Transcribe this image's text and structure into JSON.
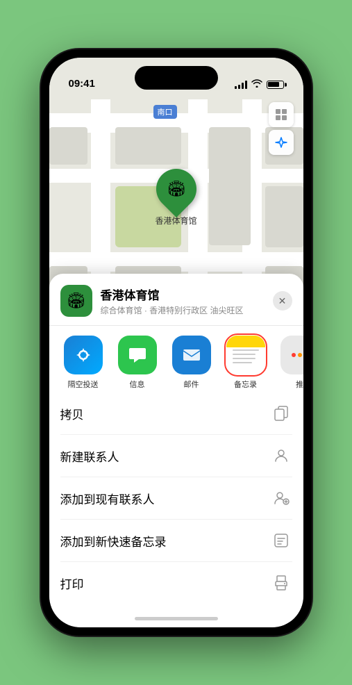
{
  "status_bar": {
    "time": "09:41",
    "location_arrow": "▶"
  },
  "map": {
    "label": "南口",
    "stadium_name": "香港体育馆",
    "controls": {
      "map_icon": "🗺",
      "location_icon": "⬆"
    }
  },
  "venue": {
    "icon": "🏟",
    "name": "香港体育馆",
    "subtitle": "综合体育馆 · 香港特别行政区 油尖旺区",
    "close_label": "✕"
  },
  "share_apps": [
    {
      "id": "airdrop",
      "label": "隔空投送",
      "type": "airdrop",
      "selected": false
    },
    {
      "id": "messages",
      "label": "信息",
      "type": "messages",
      "selected": false
    },
    {
      "id": "mail",
      "label": "邮件",
      "type": "mail",
      "selected": false
    },
    {
      "id": "notes",
      "label": "备忘录",
      "type": "notes",
      "selected": true
    },
    {
      "id": "more",
      "label": "推",
      "type": "more",
      "selected": false
    }
  ],
  "actions": [
    {
      "id": "copy",
      "label": "拷贝",
      "icon": "copy"
    },
    {
      "id": "new-contact",
      "label": "新建联系人",
      "icon": "person"
    },
    {
      "id": "add-existing",
      "label": "添加到现有联系人",
      "icon": "person-add"
    },
    {
      "id": "add-notes",
      "label": "添加到新快速备忘录",
      "icon": "notes"
    },
    {
      "id": "print",
      "label": "打印",
      "icon": "print"
    }
  ]
}
